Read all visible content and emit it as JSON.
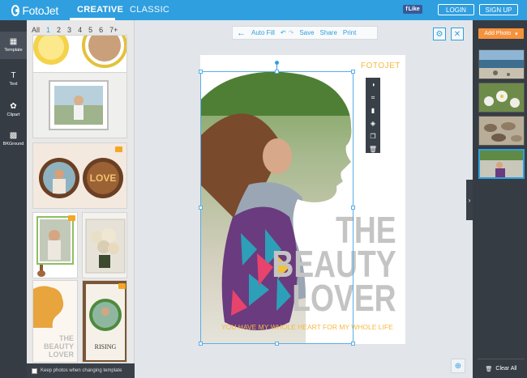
{
  "app": {
    "logo_text": "FotoJet"
  },
  "topbar": {
    "modes": [
      "CREATIVE",
      "CLASSIC"
    ],
    "fb_like": "Like",
    "login": "LOGIN",
    "signup": "SIGN UP"
  },
  "leftnav": {
    "items": [
      "Template",
      "Text",
      "Clipart",
      "BKGround"
    ]
  },
  "templates": {
    "pages": [
      "All",
      "1",
      "2",
      "3",
      "4",
      "5",
      "6",
      "7+"
    ],
    "active_page": "1",
    "thumb3_text": "LOVE",
    "thumb6_text": [
      "THE",
      "BEAUTY",
      "LOVER"
    ],
    "thumb7_text": "RISING"
  },
  "keep_photos": "Keep photos when changing template",
  "toolbar": {
    "auto_fill": "Auto Fill",
    "save": "Save",
    "share": "Share",
    "print": "Print"
  },
  "canvas": {
    "brand": "FOTOJET",
    "headline": [
      "THE",
      "BEAUTY",
      "LOVER"
    ],
    "tagline": "YOU HAVE MY WHOLE HEART FOR MY WHOLE LIFE"
  },
  "right": {
    "add_photo": "Add Photo",
    "clear_all": "Clear All"
  },
  "colors": {
    "accent": "#2f9fe0",
    "orange": "#f5923e",
    "gold": "#f5b941",
    "dark": "#363c44"
  }
}
